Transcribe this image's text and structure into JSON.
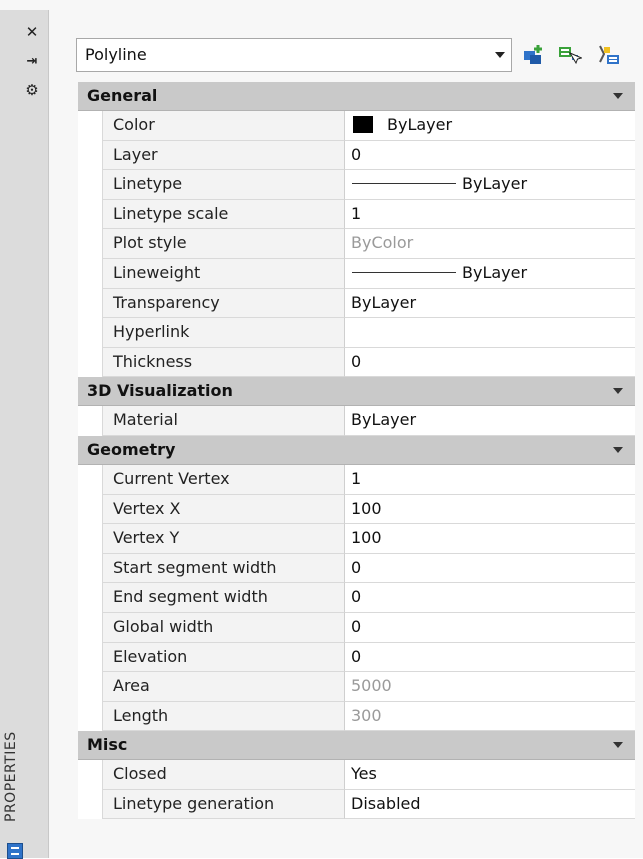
{
  "strip": {
    "close_glyph": "✕",
    "autohide_glyph": "⇥",
    "settings_glyph": "⚙",
    "title": "PROPERTIES",
    "icon": "properties-icon"
  },
  "selector": {
    "value": "Polyline",
    "toolbar_icons": [
      "toggle-pickadd-icon",
      "select-objects-icon",
      "quick-select-icon"
    ]
  },
  "sections": {
    "general": {
      "title": "General",
      "rows": {
        "color": {
          "name": "Color",
          "value": "ByLayer"
        },
        "layer": {
          "name": "Layer",
          "value": "0"
        },
        "linetype": {
          "name": "Linetype",
          "value": "ByLayer"
        },
        "linetype_scale": {
          "name": "Linetype scale",
          "value": "1"
        },
        "plot_style": {
          "name": "Plot style",
          "value": "ByColor"
        },
        "lineweight": {
          "name": "Lineweight",
          "value": "ByLayer"
        },
        "transparency": {
          "name": "Transparency",
          "value": "ByLayer"
        },
        "hyperlink": {
          "name": "Hyperlink",
          "value": ""
        },
        "thickness": {
          "name": "Thickness",
          "value": "0"
        }
      }
    },
    "visualization": {
      "title": "3D Visualization",
      "rows": {
        "material": {
          "name": "Material",
          "value": "ByLayer"
        }
      }
    },
    "geometry": {
      "title": "Geometry",
      "rows": {
        "current_vertex": {
          "name": "Current Vertex",
          "value": "1"
        },
        "vertex_x": {
          "name": "Vertex X",
          "value": "100"
        },
        "vertex_y": {
          "name": "Vertex Y",
          "value": "100"
        },
        "start_width": {
          "name": "Start segment width",
          "value": "0"
        },
        "end_width": {
          "name": "End segment width",
          "value": "0"
        },
        "global_width": {
          "name": "Global width",
          "value": "0"
        },
        "elevation": {
          "name": "Elevation",
          "value": "0"
        },
        "area": {
          "name": "Area",
          "value": "5000"
        },
        "length": {
          "name": "Length",
          "value": "300"
        }
      }
    },
    "misc": {
      "title": "Misc",
      "rows": {
        "closed": {
          "name": "Closed",
          "value": "Yes"
        },
        "linetype_generation": {
          "name": "Linetype generation",
          "value": "Disabled"
        }
      }
    }
  },
  "colors": {
    "header_bg": "#c9c9c9",
    "readonly_text": "#9a9a9a",
    "icon_blue": "#2f73c9",
    "icon_green": "#3aa23a"
  }
}
